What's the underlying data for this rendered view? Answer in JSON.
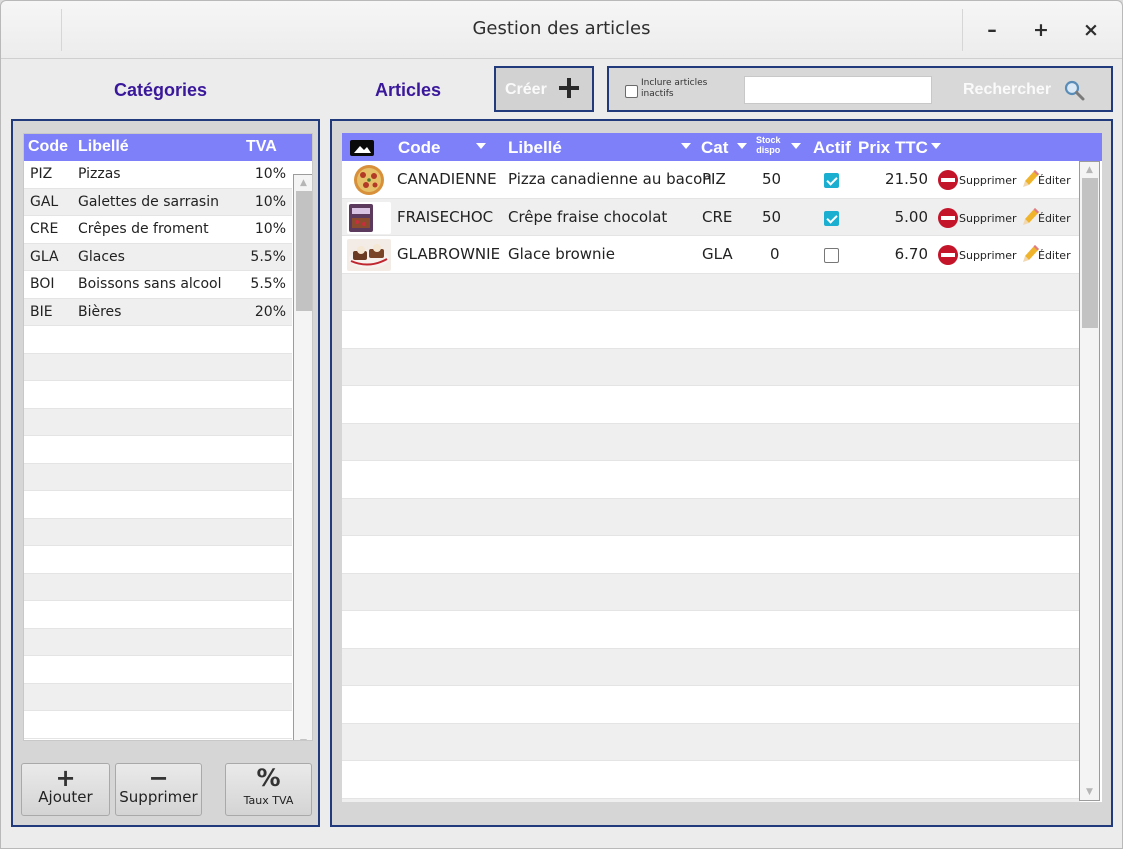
{
  "window": {
    "title": "Gestion des articles",
    "minimize": "–",
    "maximize": "+",
    "close": "×"
  },
  "header": {
    "categories_label": "Catégories",
    "articles_label": "Articles",
    "create_label": "Créer",
    "include_inactive_label": "Inclure articles inactifs",
    "search_value": "",
    "search_label": "Rechercher"
  },
  "categories": {
    "columns": [
      "Code",
      "Libellé",
      "TVA"
    ],
    "rows": [
      {
        "code": "PIZ",
        "label": "Pizzas",
        "tva": "10%"
      },
      {
        "code": "GAL",
        "label": "Galettes de sarrasin",
        "tva": "10%"
      },
      {
        "code": "CRE",
        "label": "Crêpes de froment",
        "tva": "10%"
      },
      {
        "code": "GLA",
        "label": "Glaces",
        "tva": "5.5%"
      },
      {
        "code": "BOI",
        "label": "Boissons sans alcool",
        "tva": "5.5%"
      },
      {
        "code": "BIE",
        "label": "Bières",
        "tva": "20%"
      }
    ],
    "buttons": {
      "add": {
        "symbol": "+",
        "label": "Ajouter"
      },
      "delete": {
        "symbol": "−",
        "label": "Supprimer"
      },
      "tva": {
        "symbol": "%",
        "label": "Taux TVA"
      }
    }
  },
  "articles": {
    "columns": {
      "code": "Code",
      "label": "Libellé",
      "cat": "Cat",
      "stock_line1": "Stock",
      "stock_line2": "dispo",
      "active": "Actif",
      "price": "Prix TTC"
    },
    "rows": [
      {
        "image": "pizza-image",
        "code": "CANADIENNE",
        "label": "Pizza canadienne au bacon",
        "cat": "PIZ",
        "stock": "50",
        "active": true,
        "price": "21.50"
      },
      {
        "image": "crepe-image",
        "code": "FRAISECHOC",
        "label": "Crêpe fraise chocolat",
        "cat": "CRE",
        "stock": "50",
        "active": true,
        "price": "5.00"
      },
      {
        "image": "glace-image",
        "code": "GLABROWNIE",
        "label": "Glace brownie",
        "cat": "GLA",
        "stock": "0",
        "active": false,
        "price": "6.70"
      }
    ],
    "delete_label": "Supprimer",
    "edit_label": "Éditer"
  },
  "colors": {
    "header_bg": "#7e80fa",
    "panel_border": "#203a7c",
    "title_accent": "#3a189b",
    "checkbox_on": "#1aafd0",
    "delete_red": "#c3142a"
  }
}
